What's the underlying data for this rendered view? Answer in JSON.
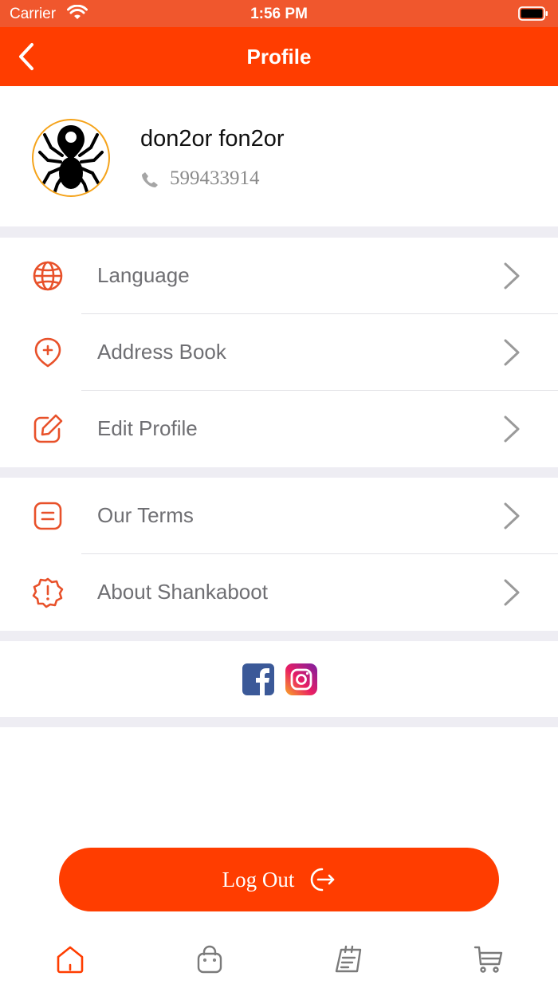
{
  "status_bar": {
    "carrier": "Carrier",
    "time": "1:56 PM"
  },
  "header": {
    "title": "Profile",
    "back_icon": "chevron-left-icon"
  },
  "profile": {
    "name": "don2or fon2or",
    "phone": "599433914",
    "phone_icon": "phone-icon",
    "avatar_icon": "spider-logo"
  },
  "menu_sections": [
    {
      "items": [
        {
          "label": "Language",
          "icon": "globe-icon"
        },
        {
          "label": "Address Book",
          "icon": "map-pin-plus-icon"
        },
        {
          "label": "Edit Profile",
          "icon": "edit-icon"
        }
      ]
    },
    {
      "items": [
        {
          "label": "Our Terms",
          "icon": "document-icon"
        },
        {
          "label": "About Shankaboot",
          "icon": "info-badge-icon"
        }
      ]
    }
  ],
  "social": {
    "facebook_icon": "facebook-icon",
    "instagram_icon": "instagram-icon"
  },
  "logout": {
    "label": "Log Out",
    "icon": "logout-icon"
  },
  "tab_bar": [
    {
      "name": "home",
      "icon": "home-icon",
      "active": true
    },
    {
      "name": "shop",
      "icon": "bag-icon",
      "active": false
    },
    {
      "name": "orders",
      "icon": "notes-icon",
      "active": false
    },
    {
      "name": "cart",
      "icon": "cart-icon",
      "active": false
    }
  ],
  "colors": {
    "accent": "#ff3d00",
    "status_bar": "#f0572d",
    "icon": "#e8512a",
    "background_band": "#eeedf3",
    "text_muted": "#6f6f73",
    "avatar_ring": "#f5a31a"
  }
}
